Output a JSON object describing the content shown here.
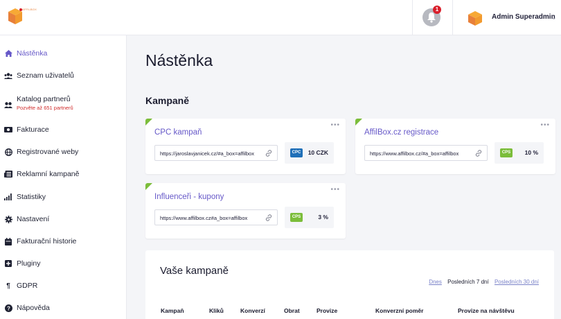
{
  "topbar": {
    "logo_text": "AFFILBOX",
    "notifications_count": "1",
    "user_name": "Admin Superadmin",
    "chevron": "⌄"
  },
  "sidebar": {
    "items": [
      {
        "label": "Nástěnka",
        "icon": "home-icon",
        "active": true
      },
      {
        "label": "Seznam uživatelů",
        "icon": "users-icon"
      },
      {
        "label": "Katalog partnerů",
        "icon": "partners-icon",
        "sub": "Pozvěte až 651 partnerů"
      },
      {
        "label": "Fakturace",
        "icon": "money-icon"
      },
      {
        "label": "Registrované weby",
        "icon": "globe-icon"
      },
      {
        "label": "Reklamní kampaně",
        "icon": "newspaper-icon"
      },
      {
        "label": "Statistiky",
        "icon": "bar-chart-icon"
      },
      {
        "label": "Nastavení",
        "icon": "gear-icon"
      },
      {
        "label": "Fakturační historie",
        "icon": "calendar-icon"
      },
      {
        "label": "Pluginy",
        "icon": "plus-square-icon"
      },
      {
        "label": "GDPR",
        "icon": "paragraph-icon"
      },
      {
        "label": "Nápověda",
        "icon": "help-icon"
      }
    ]
  },
  "main": {
    "title": "Nástěnka",
    "section": "Kampaně",
    "campaigns": [
      {
        "title": "CPC kampaň",
        "link": "https://jaroslavjanicek.cz/#a_box=affilbox",
        "type": "CPC",
        "type_color": "#1f6fb8",
        "value": "10 CZK",
        "dots": "•••"
      },
      {
        "title": "AffilBox.cz registrace",
        "link": "https://www.affilbox.cz/#a_box=affilbox",
        "type": "CPS",
        "type_color": "#7bbd3a",
        "value": "10 %",
        "dots": "•••"
      },
      {
        "title": "Influenceři - kupony",
        "link": "https://www.affilbox.cz#a_box=affilbox",
        "type": "CPS",
        "type_color": "#7bbd3a",
        "value": "3 %",
        "dots": "•••"
      }
    ],
    "your_campaigns": {
      "title": "Vaše kampaně",
      "filters": {
        "today": "Dnes",
        "last7": "Posledních 7 dní",
        "last30": "Posledních 30 dní"
      },
      "columns": [
        "Kampaň",
        "Kliků",
        "Konverzí",
        "Obrat",
        "Provize",
        "Konverzní poměr",
        "Provize na návštěvu"
      ]
    }
  }
}
